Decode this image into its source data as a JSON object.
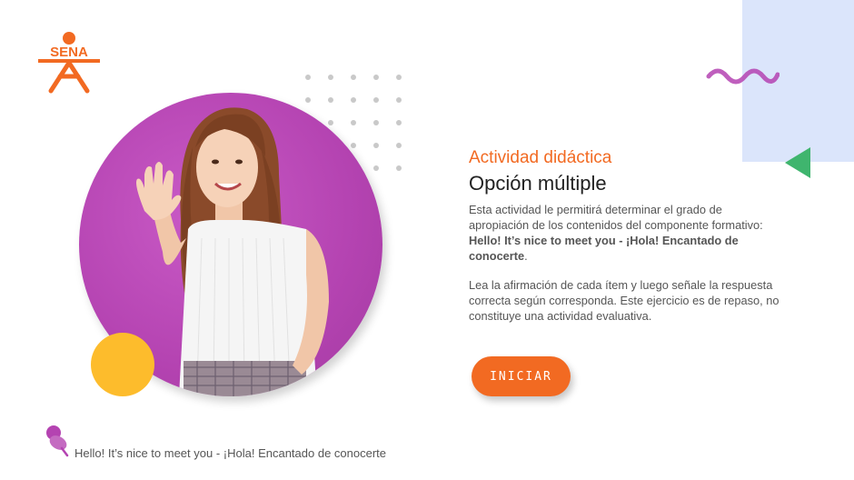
{
  "brand": {
    "logo_text": "SENA"
  },
  "colors": {
    "accent": "#f26a22",
    "purple": "#b443b1",
    "yellow": "#fdbc2c",
    "green": "#3fb56e",
    "light_blue": "#dbe5fb"
  },
  "intro": {
    "kicker": "Actividad didáctica",
    "title": "Opción múltiple",
    "description_prefix": "Esta actividad le permitirá determinar el grado de apropiación de los contenidos del componente formativo: ",
    "description_topic": "Hello!  It’s nice to meet you - ¡Hola!  Encantado de conocerte",
    "description_suffix": ".",
    "instructions": "Lea la afirmación de cada ítem y luego señale la respuesta correcta según corresponda.  Este ejercicio es de repaso, no constituye una actividad evaluativa.",
    "start_button": "INICIAR"
  },
  "footer": {
    "pin_icon": "pushpin-icon",
    "text": "Hello!  It’s nice to meet you - ¡Hola!  Encantado de conocerte"
  }
}
